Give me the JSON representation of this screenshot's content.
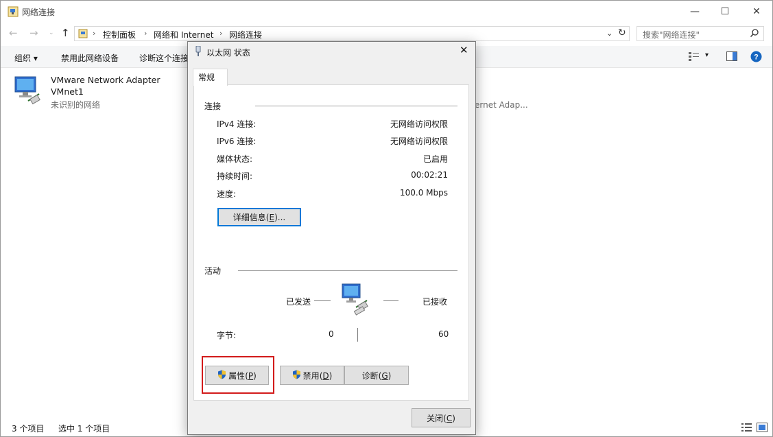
{
  "window": {
    "title": "网络连接",
    "minimize": "—",
    "maximize": "☐",
    "close": "✕"
  },
  "address": {
    "crumbs": [
      "控制面板",
      "网络和 Internet",
      "网络连接"
    ],
    "search_placeholder": "搜索\"网络连接\""
  },
  "toolbar": {
    "organize": "组织",
    "disable": "禁用此网络设备",
    "diagnose": "诊断这个连接"
  },
  "items": [
    {
      "name": "VMware Network Adapter",
      "name2": "VMnet1",
      "status": "未识别的网络"
    }
  ],
  "partial_item_text": "ernet Adap...",
  "statusbar": {
    "count": "3 个项目",
    "selected": "选中 1 个项目"
  },
  "dialog": {
    "title": "以太网 状态",
    "tab": "常规",
    "connection_group": "连接",
    "rows": [
      {
        "label": "IPv4 连接:",
        "value": "无网络访问权限"
      },
      {
        "label": "IPv6 连接:",
        "value": "无网络访问权限"
      },
      {
        "label": "媒体状态:",
        "value": "已启用"
      },
      {
        "label": "持续时间:",
        "value": "00:02:21"
      },
      {
        "label": "速度:",
        "value": "100.0 Mbps"
      }
    ],
    "details_button": {
      "text": "详细信息",
      "key": "E",
      "suffix": "..."
    },
    "activity_group": "活动",
    "sent_label": "已发送",
    "received_label": "已接收",
    "bytes_label": "字节:",
    "bytes_sent": "0",
    "bytes_received": "60",
    "properties_button": {
      "text": "属性",
      "key": "P"
    },
    "disable_button": {
      "text": "禁用",
      "key": "D"
    },
    "diagnose_button": {
      "text": "诊断",
      "key": "G"
    },
    "close_button": {
      "text": "关闭",
      "key": "C"
    }
  },
  "colors": {
    "highlight": "#d21a1a",
    "focus": "#0078d7",
    "help": "#1565c0"
  }
}
